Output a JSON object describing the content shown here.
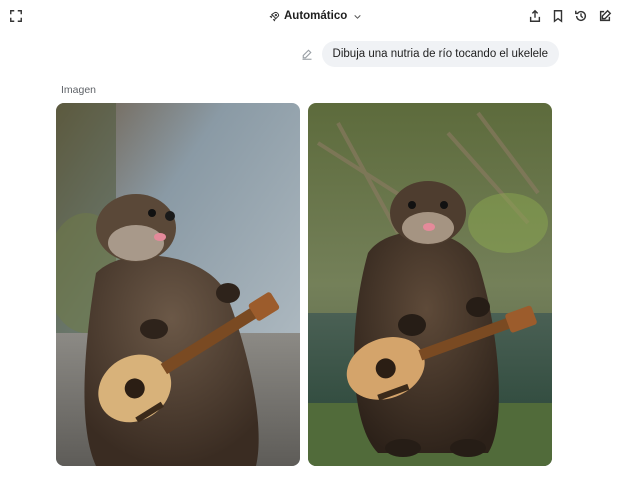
{
  "header": {
    "model_label": "Automático",
    "icons": [
      "expand-icon",
      "rocket-icon",
      "chevron-down-icon",
      "share-icon",
      "bookmark-icon",
      "history-icon",
      "new-chat-icon"
    ]
  },
  "conversation": {
    "user_message": "Dibuja una nutria de río tocando el ukelele"
  },
  "response": {
    "section_label": "Imagen",
    "images": [
      {
        "subject": "otter-playing-ukulele-1"
      },
      {
        "subject": "otter-playing-ukulele-2"
      }
    ]
  },
  "colors": {
    "bubble_bg": "#f0f2f5",
    "text": "#1f1f1f",
    "muted": "#5f6368"
  }
}
